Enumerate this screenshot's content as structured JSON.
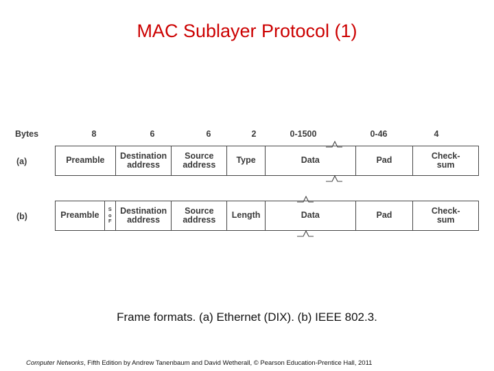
{
  "slide": {
    "title": "MAC Sublayer Protocol (1)",
    "caption": "Frame formats. (a) Ethernet (DIX). (b) IEEE 802.3.",
    "footer_italic": "Computer Networks",
    "footer_rest": ", Fifth Edition by Andrew Tanenbaum and David Wetherall, © Pearson Education-Prentice Hall, 2011",
    "accent_color": "#cc0000",
    "text_color": "#3a3a3a"
  },
  "figure": {
    "bytes_label": "Bytes",
    "size_headers": [
      "8",
      "6",
      "6",
      "2",
      "0-1500",
      "0-46",
      "4"
    ],
    "rows": [
      {
        "label": "(a)",
        "cells": [
          {
            "lines": [
              "Preamble"
            ]
          },
          {
            "lines": [
              "Destination",
              "address"
            ]
          },
          {
            "lines": [
              "Source",
              "address"
            ]
          },
          {
            "lines": [
              "Type"
            ]
          },
          {
            "lines": [
              "Data"
            ]
          },
          {
            "lines": [
              "Pad"
            ]
          },
          {
            "lines": [
              "Check-",
              "sum"
            ]
          }
        ]
      },
      {
        "label": "(b)",
        "cells": [
          {
            "lines": [
              "Preamble"
            ]
          },
          {
            "lines": [
              "S",
              "o",
              "F"
            ],
            "small": true
          },
          {
            "lines": [
              "Destination",
              "address"
            ]
          },
          {
            "lines": [
              "Source",
              "address"
            ]
          },
          {
            "lines": [
              "Length"
            ]
          },
          {
            "lines": [
              "Data"
            ]
          },
          {
            "lines": [
              "Pad"
            ]
          },
          {
            "lines": [
              "Check-",
              "sum"
            ]
          }
        ]
      }
    ]
  }
}
